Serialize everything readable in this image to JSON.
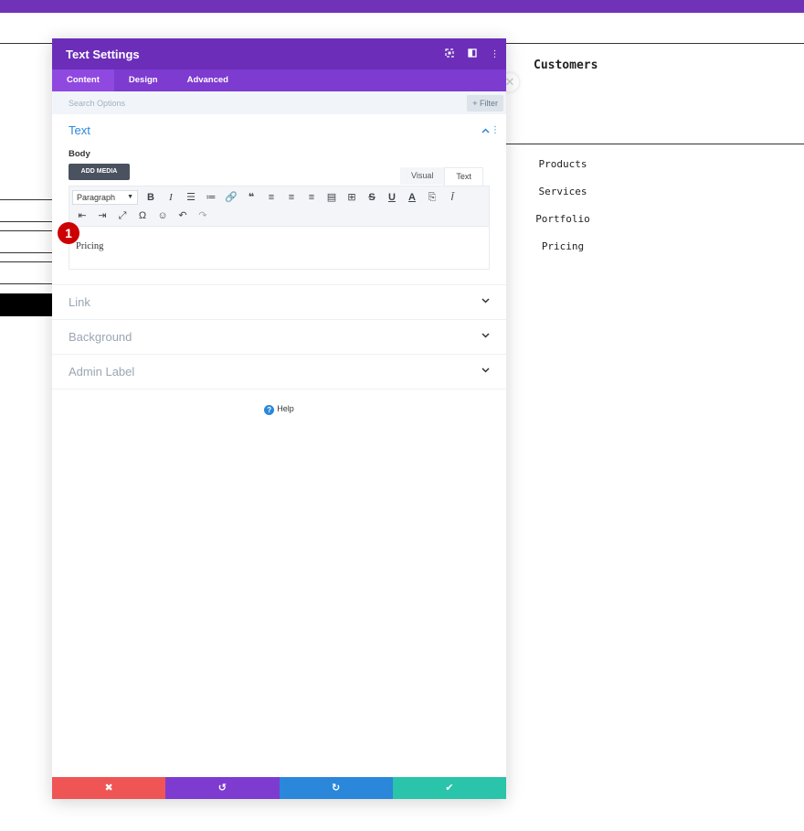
{
  "colors": {
    "top_bar": "#7033b8",
    "header": "#6c2eb9",
    "tabs_bar": "#7e3bd0",
    "active_tab": "#8f49e0",
    "accent": "#2b87da",
    "badge": "#cc0000",
    "discard": "#ef5555",
    "undo": "#7e3bd0",
    "redo": "#2b87da",
    "save": "#29c4a9"
  },
  "background_page": {
    "title": "Customers",
    "menu_items": [
      "Products",
      "Services",
      "Portfolio",
      "Pricing"
    ],
    "close_icon": "close-circle-icon"
  },
  "modal": {
    "title": "Text Settings",
    "header_icons": [
      "fullscreen-icon",
      "sidebar-toggle-icon",
      "more-options-icon"
    ],
    "tabs": [
      {
        "label": "Content",
        "active": true
      },
      {
        "label": "Design",
        "active": false
      },
      {
        "label": "Advanced",
        "active": false
      }
    ],
    "search": {
      "placeholder": "Search Options",
      "filter_label": "+ Filter"
    },
    "text_section": {
      "heading": "Text",
      "body_label": "Body",
      "add_media_label": "ADD MEDIA",
      "view_tabs": [
        "Visual",
        "Text"
      ],
      "format_select": "Paragraph",
      "toolbar_row1": [
        "bold-icon",
        "italic-icon",
        "bullet-list-icon",
        "numbered-list-icon",
        "link-icon",
        "blockquote-icon",
        "align-left-icon",
        "align-center-icon",
        "align-right-icon",
        "justify-icon",
        "table-icon",
        "strikethrough-icon",
        "underline-icon",
        "text-color-icon",
        "paste-text-icon",
        "clear-format-icon"
      ],
      "toolbar_row2": [
        "indent-icon",
        "outdent-icon",
        "fullscreen-icon",
        "special-char-icon",
        "emoji-icon",
        "undo-icon",
        "redo-icon"
      ],
      "content": "Pricing"
    },
    "collapsed_sections": [
      "Link",
      "Background",
      "Admin Label"
    ],
    "help_label": "Help",
    "step_badge": "1"
  }
}
